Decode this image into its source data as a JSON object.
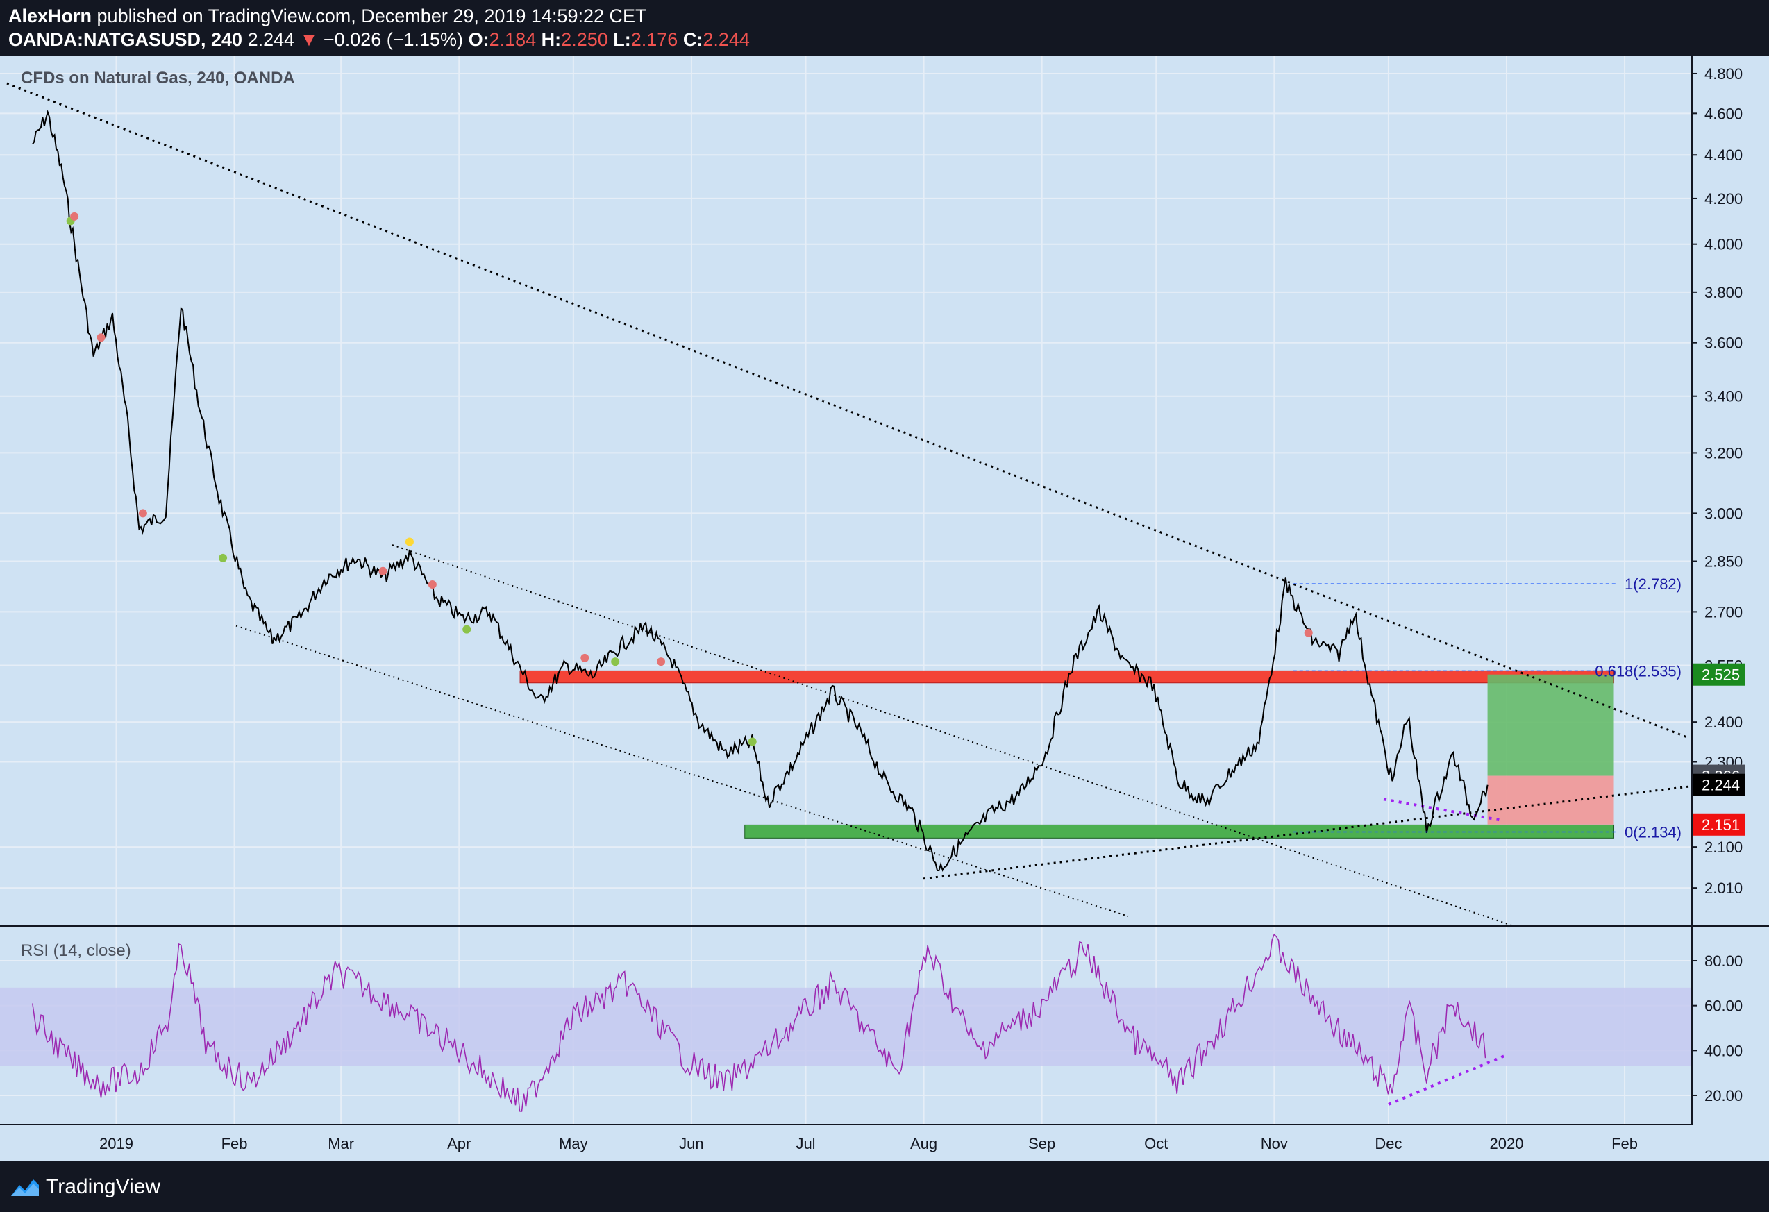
{
  "header": {
    "author": "AlexHorn",
    "published_text": " published on TradingView.com, December 29, 2019 14:59:22 CET",
    "symbol": "OANDA:NATGASUSD, 240",
    "last": "2.244",
    "arrow": "▼",
    "change": "−0.026 (−1.15%)",
    "o_label": "O:",
    "o_value": "2.184",
    "h_label": "H:",
    "h_value": "2.250",
    "l_label": "L:",
    "l_value": "2.176",
    "c_label": "C:",
    "c_value": "2.244"
  },
  "footer": {
    "brand": "TradingView",
    "logo_icon": "tradingview-logo-icon"
  },
  "colors": {
    "background": "#131722",
    "pane": "#cfe2f3",
    "candle": "#000000",
    "resistance_zone": "#f44336",
    "support_zone": "#4caf50",
    "target_zone": "#66bb6a",
    "stop_zone": "#ef9a9a",
    "rsi_line": "#9c27b0",
    "rsi_band": "#c5c9f0",
    "fib_line": "#2962ff",
    "divergence": "#a020f0"
  },
  "chart_data": [
    {
      "type": "candlestick",
      "title": "CFDs on Natural Gas, 240, OANDA",
      "y_axis_ticks": [
        "4.800",
        "4.600",
        "4.400",
        "4.200",
        "4.000",
        "3.800",
        "3.600",
        "3.400",
        "3.200",
        "3.000",
        "2.850",
        "2.700",
        "2.550",
        "2.400",
        "2.300",
        "2.100",
        "2.010"
      ],
      "y_scale": "log",
      "ylim": [
        1.95,
        4.85
      ],
      "x_axis_ticks": [
        "2019",
        "Feb",
        "Mar",
        "Apr",
        "May",
        "Jun",
        "Jul",
        "Aug",
        "Sep",
        "Oct",
        "Nov",
        "Dec",
        "2020",
        "Feb"
      ],
      "price_path": [
        [
          "2018-12-10",
          4.45
        ],
        [
          "2018-12-14",
          4.6
        ],
        [
          "2018-12-18",
          4.3
        ],
        [
          "2018-12-21",
          4.0
        ],
        [
          "2018-12-26",
          3.55
        ],
        [
          "2018-12-31",
          3.7
        ],
        [
          "2019-01-04",
          3.3
        ],
        [
          "2019-01-07",
          2.95
        ],
        [
          "2019-01-14",
          3.0
        ],
        [
          "2019-01-18",
          3.75
        ],
        [
          "2019-01-23",
          3.35
        ],
        [
          "2019-01-28",
          3.05
        ],
        [
          "2019-02-04",
          2.75
        ],
        [
          "2019-02-11",
          2.62
        ],
        [
          "2019-02-18",
          2.68
        ],
        [
          "2019-02-25",
          2.8
        ],
        [
          "2019-03-05",
          2.86
        ],
        [
          "2019-03-12",
          2.8
        ],
        [
          "2019-03-19",
          2.87
        ],
        [
          "2019-03-26",
          2.74
        ],
        [
          "2019-04-02",
          2.68
        ],
        [
          "2019-04-09",
          2.7
        ],
        [
          "2019-04-15",
          2.58
        ],
        [
          "2019-04-22",
          2.45
        ],
        [
          "2019-04-29",
          2.55
        ],
        [
          "2019-05-06",
          2.52
        ],
        [
          "2019-05-13",
          2.6
        ],
        [
          "2019-05-20",
          2.66
        ],
        [
          "2019-05-27",
          2.56
        ],
        [
          "2019-06-03",
          2.4
        ],
        [
          "2019-06-10",
          2.32
        ],
        [
          "2019-06-17",
          2.35
        ],
        [
          "2019-06-21",
          2.2
        ],
        [
          "2019-06-28",
          2.3
        ],
        [
          "2019-07-08",
          2.48
        ],
        [
          "2019-07-15",
          2.38
        ],
        [
          "2019-07-22",
          2.25
        ],
        [
          "2019-07-29",
          2.18
        ],
        [
          "2019-08-05",
          2.05
        ],
        [
          "2019-08-12",
          2.12
        ],
        [
          "2019-08-19",
          2.18
        ],
        [
          "2019-08-26",
          2.22
        ],
        [
          "2019-09-02",
          2.32
        ],
        [
          "2019-09-09",
          2.55
        ],
        [
          "2019-09-16",
          2.7
        ],
        [
          "2019-09-23",
          2.55
        ],
        [
          "2019-09-30",
          2.5
        ],
        [
          "2019-10-07",
          2.25
        ],
        [
          "2019-10-14",
          2.2
        ],
        [
          "2019-10-21",
          2.28
        ],
        [
          "2019-10-28",
          2.35
        ],
        [
          "2019-11-04",
          2.78
        ],
        [
          "2019-11-11",
          2.62
        ],
        [
          "2019-11-18",
          2.58
        ],
        [
          "2019-11-22",
          2.7
        ],
        [
          "2019-11-27",
          2.45
        ],
        [
          "2019-12-02",
          2.25
        ],
        [
          "2019-12-06",
          2.42
        ],
        [
          "2019-12-11",
          2.14
        ],
        [
          "2019-12-18",
          2.32
        ],
        [
          "2019-12-23",
          2.17
        ],
        [
          "2019-12-27",
          2.244
        ]
      ],
      "zones": [
        {
          "name": "resistance",
          "from": 2.51,
          "to": 2.535
        },
        {
          "name": "support",
          "from": 2.12,
          "to": 2.15
        }
      ],
      "fibonacci": [
        {
          "label": "1(2.782)",
          "price": 2.782
        },
        {
          "label": "0.618(2.535)",
          "price": 2.535
        },
        {
          "label": "0(2.134)",
          "price": 2.134
        }
      ],
      "position": {
        "entry": 2.151,
        "target": 2.525,
        "stop": 2.151,
        "current": 2.244,
        "mark": 2.266
      },
      "price_labels": [
        {
          "text": "2.525",
          "kind": "target"
        },
        {
          "text": "2.266",
          "kind": "mark"
        },
        {
          "text": "2.244",
          "kind": "last"
        },
        {
          "text": "2.151",
          "kind": "stop"
        }
      ],
      "signal_dots": [
        {
          "date": "2018-12-20",
          "price": 4.1,
          "color": "green"
        },
        {
          "date": "2018-12-21",
          "price": 4.12,
          "color": "red"
        },
        {
          "date": "2018-12-28",
          "price": 3.62,
          "color": "red"
        },
        {
          "date": "2019-01-08",
          "price": 3.0,
          "color": "red"
        },
        {
          "date": "2019-01-29",
          "price": 2.86,
          "color": "green"
        },
        {
          "date": "2019-03-12",
          "price": 2.82,
          "color": "red"
        },
        {
          "date": "2019-03-19",
          "price": 2.91,
          "color": "yellow"
        },
        {
          "date": "2019-03-25",
          "price": 2.78,
          "color": "red"
        },
        {
          "date": "2019-04-03",
          "price": 2.65,
          "color": "green"
        },
        {
          "date": "2019-05-04",
          "price": 2.57,
          "color": "red"
        },
        {
          "date": "2019-05-12",
          "price": 2.56,
          "color": "green"
        },
        {
          "date": "2019-05-24",
          "price": 2.56,
          "color": "red"
        },
        {
          "date": "2019-06-17",
          "price": 2.35,
          "color": "green"
        },
        {
          "date": "2019-11-10",
          "price": 2.64,
          "color": "red"
        }
      ]
    },
    {
      "type": "line",
      "title": "RSI (14, close)",
      "y_axis_ticks": [
        "80.00",
        "60.00",
        "40.00",
        "20.00"
      ],
      "ylim": [
        7,
        93
      ],
      "band": [
        33,
        68
      ],
      "series": [
        {
          "values_path": [
            [
              "2018-12-10",
              55
            ],
            [
              "2018-12-20",
              35
            ],
            [
              "2018-12-28",
              25
            ],
            [
              "2019-01-07",
              30
            ],
            [
              "2019-01-15",
              55
            ],
            [
              "2019-01-18",
              88
            ],
            [
              "2019-01-25",
              40
            ],
            [
              "2019-02-05",
              25
            ],
            [
              "2019-02-15",
              45
            ],
            [
              "2019-02-28",
              75
            ],
            [
              "2019-03-15",
              60
            ],
            [
              "2019-04-01",
              40
            ],
            [
              "2019-04-18",
              15
            ],
            [
              "2019-05-01",
              55
            ],
            [
              "2019-05-15",
              70
            ],
            [
              "2019-05-31",
              35
            ],
            [
              "2019-06-10",
              25
            ],
            [
              "2019-06-21",
              40
            ],
            [
              "2019-07-08",
              70
            ],
            [
              "2019-07-25",
              30
            ],
            [
              "2019-08-02",
              85
            ],
            [
              "2019-08-15",
              40
            ],
            [
              "2019-09-01",
              60
            ],
            [
              "2019-09-12",
              85
            ],
            [
              "2019-09-25",
              45
            ],
            [
              "2019-10-07",
              25
            ],
            [
              "2019-10-20",
              55
            ],
            [
              "2019-11-01",
              88
            ],
            [
              "2019-11-10",
              65
            ],
            [
              "2019-11-25",
              35
            ],
            [
              "2019-12-02",
              22
            ],
            [
              "2019-12-06",
              60
            ],
            [
              "2019-12-11",
              30
            ],
            [
              "2019-12-18",
              62
            ],
            [
              "2019-12-27",
              40
            ]
          ]
        }
      ]
    }
  ]
}
